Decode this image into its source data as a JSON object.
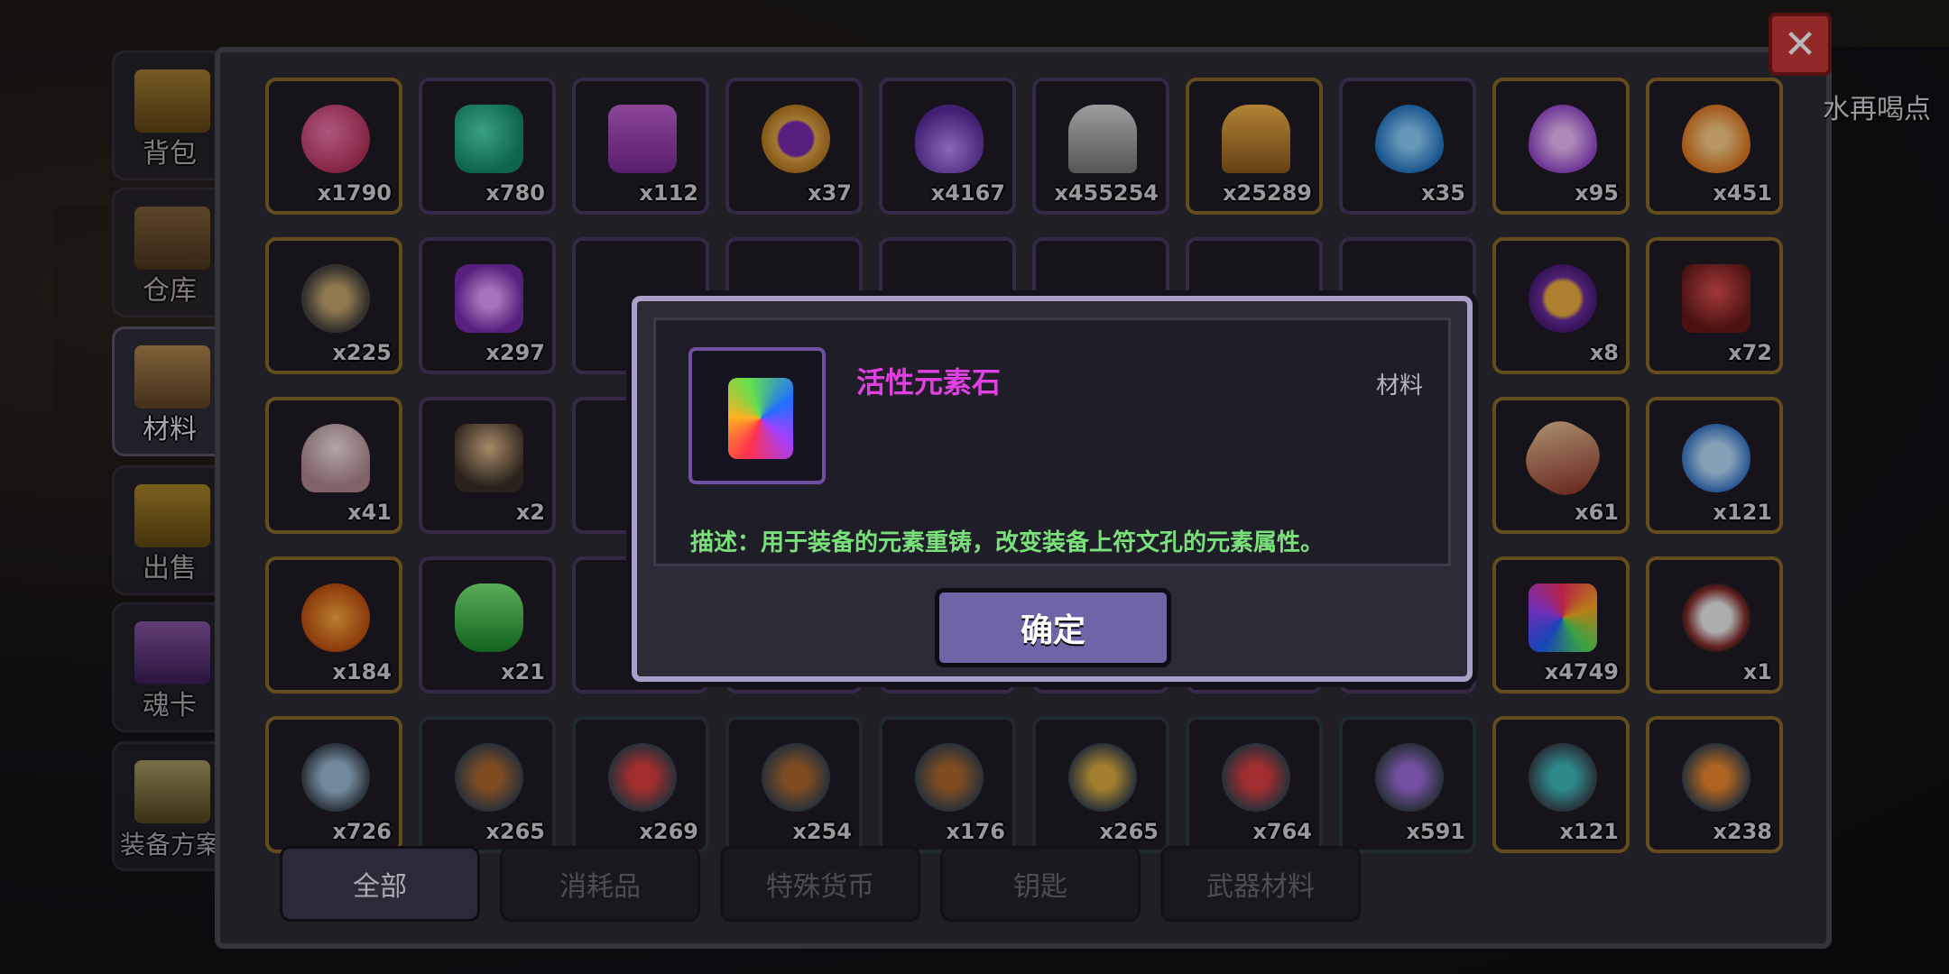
{
  "side_tabs": [
    {
      "label": "背包",
      "icon": "backpack-icon"
    },
    {
      "label": "仓库",
      "icon": "warehouse-chest-icon"
    },
    {
      "label": "材料",
      "icon": "material-book-icon",
      "active": true
    },
    {
      "label": "出售",
      "icon": "gold-sell-icon"
    },
    {
      "label": "魂卡",
      "icon": "soul-card-icon"
    },
    {
      "label": "装备方案",
      "icon": "equipment-plan-icon"
    }
  ],
  "close_label": "✕",
  "corner_text": "水再喝点",
  "grid": {
    "rows": [
      [
        {
          "icon": "pink-gem-icon",
          "count": "x1790"
        },
        {
          "icon": "teal-token-icon",
          "count": "x780"
        },
        {
          "icon": "purple-crystal-icon",
          "count": "x112"
        },
        {
          "icon": "gold-coin-icon",
          "count": "x37"
        },
        {
          "icon": "purple-flame-icon",
          "count": "x4167"
        },
        {
          "icon": "silver-ore-icon",
          "count": "x455254"
        },
        {
          "icon": "gold-ore-icon",
          "count": "x25289"
        },
        {
          "icon": "blue-key-drop-icon",
          "count": "x35"
        },
        {
          "icon": "purple-key-drop-icon",
          "count": "x95"
        },
        {
          "icon": "orange-key-drop-icon",
          "count": "x451"
        }
      ],
      [
        {
          "icon": "hourglass-icon",
          "count": "x225"
        },
        {
          "icon": "purple-key-token-icon",
          "count": "x297"
        },
        {
          "icon": "",
          "count": ""
        },
        {
          "icon": "",
          "count": ""
        },
        {
          "icon": "",
          "count": ""
        },
        {
          "icon": "",
          "count": ""
        },
        {
          "icon": "",
          "count": ""
        },
        {
          "icon": "",
          "count": ""
        },
        {
          "icon": "treasure-chest-icon",
          "count": "x8"
        },
        {
          "icon": "demon-statue-icon",
          "count": "x72"
        }
      ],
      [
        {
          "icon": "egg-statue-icon",
          "count": "x41"
        },
        {
          "icon": "wizard-statue-icon",
          "count": "x2"
        },
        {
          "icon": "",
          "count": ""
        },
        {
          "icon": "",
          "count": ""
        },
        {
          "icon": "",
          "count": ""
        },
        {
          "icon": "",
          "count": ""
        },
        {
          "icon": "",
          "count": ""
        },
        {
          "icon": "",
          "count": ""
        },
        {
          "icon": "torch-icon",
          "count": "x61"
        },
        {
          "icon": "blue-disc-icon",
          "count": "x121"
        }
      ],
      [
        {
          "icon": "pumpkin-icon",
          "count": "x184"
        },
        {
          "icon": "green-capsule-icon",
          "count": "x21"
        },
        {
          "icon": "",
          "count": ""
        },
        {
          "icon": "",
          "count": ""
        },
        {
          "icon": "",
          "count": ""
        },
        {
          "icon": "",
          "count": ""
        },
        {
          "icon": "",
          "count": ""
        },
        {
          "icon": "",
          "count": ""
        },
        {
          "icon": "elemental-crystal-icon",
          "count": "x4749"
        },
        {
          "icon": "magnifier-lens-icon",
          "count": "x1"
        }
      ],
      [
        {
          "icon": "spear-tip-icon",
          "count": "x726"
        },
        {
          "icon": "gun-icon",
          "count": "x265"
        },
        {
          "icon": "red-blade-icon",
          "count": "x269"
        },
        {
          "icon": "goggles-icon",
          "count": "x254"
        },
        {
          "icon": "rifle-icon",
          "count": "x176"
        },
        {
          "icon": "gold-sword-icon",
          "count": "x265"
        },
        {
          "icon": "red-dagger-icon",
          "count": "x764"
        },
        {
          "icon": "purple-fish-icon",
          "count": "x591"
        },
        {
          "icon": "teal-bracket-icon",
          "count": "x121"
        },
        {
          "icon": "orange-block-icon",
          "count": "x238"
        }
      ]
    ]
  },
  "filter_tabs": [
    {
      "label": "全部",
      "active": true
    },
    {
      "label": "消耗品"
    },
    {
      "label": "特殊货币"
    },
    {
      "label": "钥匙"
    },
    {
      "label": "武器材料"
    }
  ],
  "modal": {
    "item_name": "活性元素石",
    "item_type": "材料",
    "item_icon": "elemental-crystal-icon",
    "description": "描述：用于装备的元素重铸，改变装备上符文孔的元素属性。",
    "confirm_label": "确定"
  }
}
